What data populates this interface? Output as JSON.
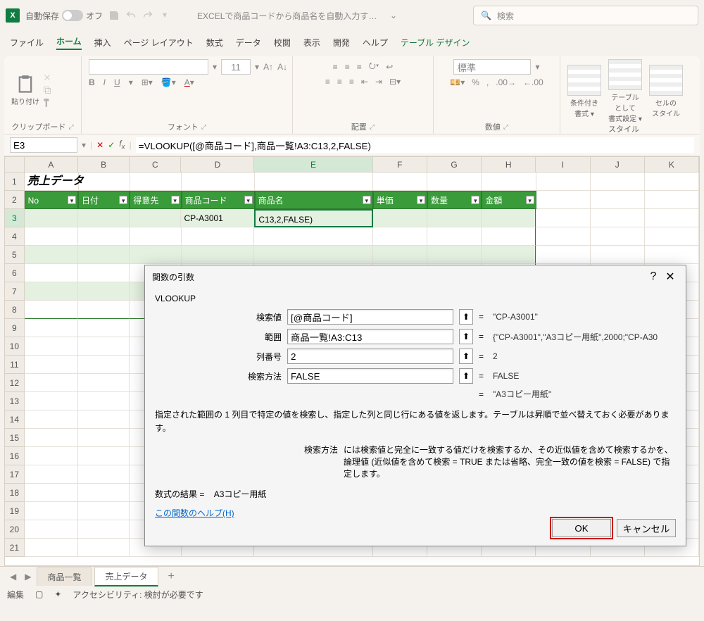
{
  "titlebar": {
    "autosave_label": "自動保存",
    "autosave_state": "オフ",
    "doc_title": "EXCELで商品コードから商品名を自動入力する方…",
    "search_placeholder": "検索"
  },
  "tabs": {
    "file": "ファイル",
    "home": "ホーム",
    "insert": "挿入",
    "pagelayout": "ページ レイアウト",
    "formulas": "数式",
    "data": "データ",
    "review": "校閲",
    "view": "表示",
    "developer": "開発",
    "help": "ヘルプ",
    "tabledesign": "テーブル デザイン"
  },
  "ribbon": {
    "paste": "貼り付け",
    "clipboard": "クリップボード",
    "font": "フォント",
    "alignment": "配置",
    "number": "数値",
    "styles": "スタイル",
    "font_size": "11",
    "number_format": "標準",
    "cond_fmt": "条件付き\n書式 ▾",
    "table_fmt": "テーブルとして\n書式設定 ▾",
    "cell_styles": "セルの\nスタイル"
  },
  "formula_bar": {
    "name_box": "E3",
    "formula": "=VLOOKUP([@商品コード],商品一覧!A3:C13,2,FALSE)"
  },
  "columns": [
    "A",
    "B",
    "C",
    "D",
    "E",
    "F",
    "G",
    "H",
    "I",
    "J",
    "K"
  ],
  "rows": [
    "1",
    "2",
    "3",
    "4",
    "5",
    "6",
    "7",
    "8",
    "9",
    "10",
    "11",
    "12",
    "13",
    "14",
    "15",
    "16",
    "17",
    "18",
    "19",
    "20",
    "21"
  ],
  "sheet": {
    "title": "売上データ",
    "headers": [
      "No",
      "日付",
      "得意先",
      "商品コード",
      "商品名",
      "単価",
      "数量",
      "金額"
    ],
    "row3_D": "CP-A3001",
    "row3_E": "C13,2,FALSE)"
  },
  "dialog": {
    "title": "関数の引数",
    "func": "VLOOKUP",
    "args": {
      "lookup_value": {
        "label": "検索値",
        "value": "[@商品コード]",
        "result": "\"CP-A3001\""
      },
      "table_array": {
        "label": "範囲",
        "value": "商品一覧!A3:C13",
        "result": "{\"CP-A3001\",\"A3コピー用紙\",2000;\"CP-A30"
      },
      "col_index": {
        "label": "列番号",
        "value": "2",
        "result": "2"
      },
      "range_lookup": {
        "label": "検索方法",
        "value": "FALSE",
        "result": "FALSE"
      }
    },
    "final_result": "\"A3コピー用紙\"",
    "description": "指定された範囲の 1 列目で特定の値を検索し、指定した列と同じ行にある値を返します。テーブルは昇順で並べ替えておく必要があります。",
    "param_label": "検索方法",
    "param_desc": "には検索値と完全に一致する値だけを検索するか、その近似値を含めて検索するかを、論理値 (近似値を含めて検索 = TRUE または省略、完全一致の値を検索 = FALSE) で指定します。",
    "formula_result_label": "数式の結果 =",
    "formula_result_value": "A3コピー用紙",
    "help_link": "この関数のヘルプ(H)",
    "ok": "OK",
    "cancel": "キャンセル",
    "help_icon": "?",
    "close_icon": "✕"
  },
  "sheet_tabs": {
    "t1": "商品一覧",
    "t2": "売上データ"
  },
  "statusbar": {
    "mode": "編集",
    "accessibility": "アクセシビリティ: 検討が必要です"
  }
}
